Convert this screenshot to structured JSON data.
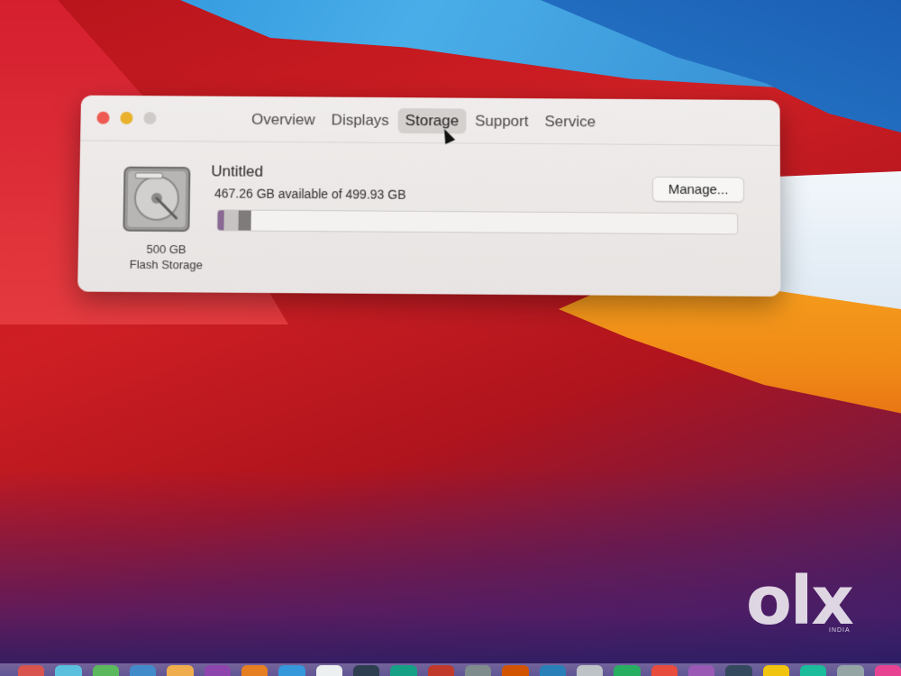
{
  "window": {
    "tabs": [
      {
        "label": "Overview",
        "active": false
      },
      {
        "label": "Displays",
        "active": false
      },
      {
        "label": "Storage",
        "active": true
      },
      {
        "label": "Support",
        "active": false
      },
      {
        "label": "Service",
        "active": false
      }
    ]
  },
  "storage": {
    "disk_size": "500 GB",
    "disk_type": "Flash Storage",
    "volume_name": "Untitled",
    "availability": "467.26 GB available of 499.93 GB",
    "manage_label": "Manage...",
    "used_fraction": 0.065,
    "segments": [
      {
        "color": "#8a6a94",
        "fraction": 0.012
      },
      {
        "color": "#c7c3c2",
        "fraction": 0.028
      },
      {
        "color": "#7e7b7a",
        "fraction": 0.025
      }
    ]
  },
  "watermark": {
    "logo": "olx",
    "sub": "INDIA"
  },
  "colors": {
    "close": "#ee5a52",
    "minimize": "#e9b12c",
    "zoom_disabled": "#cfcbc9"
  }
}
